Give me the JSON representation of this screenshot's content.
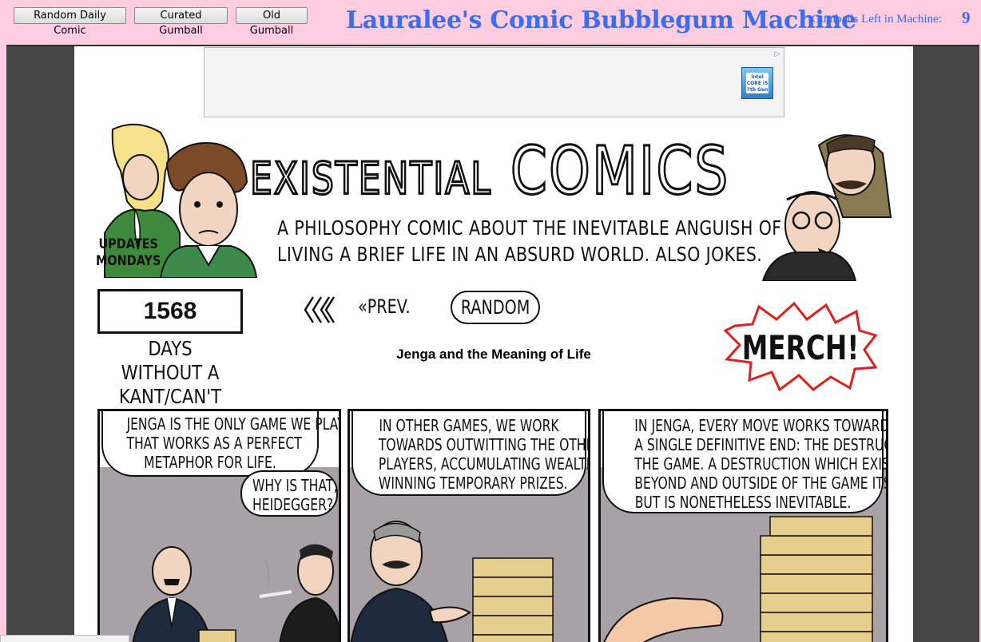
{
  "toolbar": {
    "random_daily": "Random Daily Comic",
    "curated": "Curated Gumball",
    "old": "Old Gumball"
  },
  "site": {
    "title": "Lauralee's Comic Bubblegum Machine",
    "gumballs_label": "Gumballs Left in Machine:",
    "gumballs_count": "9"
  },
  "ad": {
    "badge": "▷",
    "chip_text": "intel CORE i5 7th Gen"
  },
  "comic_site": {
    "logo_word_1": "EXISTENTIAL",
    "logo_word_2": "COMICS",
    "tagline_line_1": "A PHILOSOPHY COMIC ABOUT THE INEVITABLE ANGUISH OF",
    "tagline_line_2": "LIVING A BRIEF LIFE IN AN ABSURD WORLD. ALSO JOKES.",
    "updates_line_1": "UPDATES",
    "updates_line_2": "MONDAYS",
    "counter_value": "1568",
    "counter_caption_1": "DAYS WITHOUT A",
    "counter_caption_2": "KANT/CAN'T PUN",
    "first_label": "«",
    "prev_label": "«PREV.",
    "random_label": "RANDOM",
    "merch_label": "MERCH!",
    "comic_title": "Jenga and the Meaning of Life"
  },
  "panels": [
    {
      "bubbles": [
        [
          "JENGA IS THE ONLY GAME WE PLAY",
          "THAT WORKS AS A PERFECT",
          "METAPHOR FOR LIFE."
        ],
        [
          "WHY IS THAT,",
          "HEIDEGGER?"
        ]
      ]
    },
    {
      "bubbles": [
        [
          "IN OTHER GAMES, WE WORK",
          "TOWARDS OUTWITTING THE OTHER",
          "PLAYERS, ACCUMULATING WEALTH, OR",
          "WINNING TEMPORARY PRIZES."
        ]
      ]
    },
    {
      "bubbles": [
        [
          "IN JENGA, EVERY MOVE WORKS TOWARDS ONLY",
          "A SINGLE DEFINITIVE END: THE DESTRUCTION OF",
          "THE GAME. A DESTRUCTION WHICH EXISTS",
          "BEYOND AND OUTSIDE OF THE GAME ITSELF,",
          "BUT IS NONETHELESS INEVITABLE."
        ]
      ]
    }
  ],
  "colors": {
    "page_bg": "#ffcce0",
    "title_blue": "#3a6df0",
    "frame_gray": "#454545",
    "merch_red": "#e0201c",
    "jenga_wood": "#e6cf8e"
  }
}
